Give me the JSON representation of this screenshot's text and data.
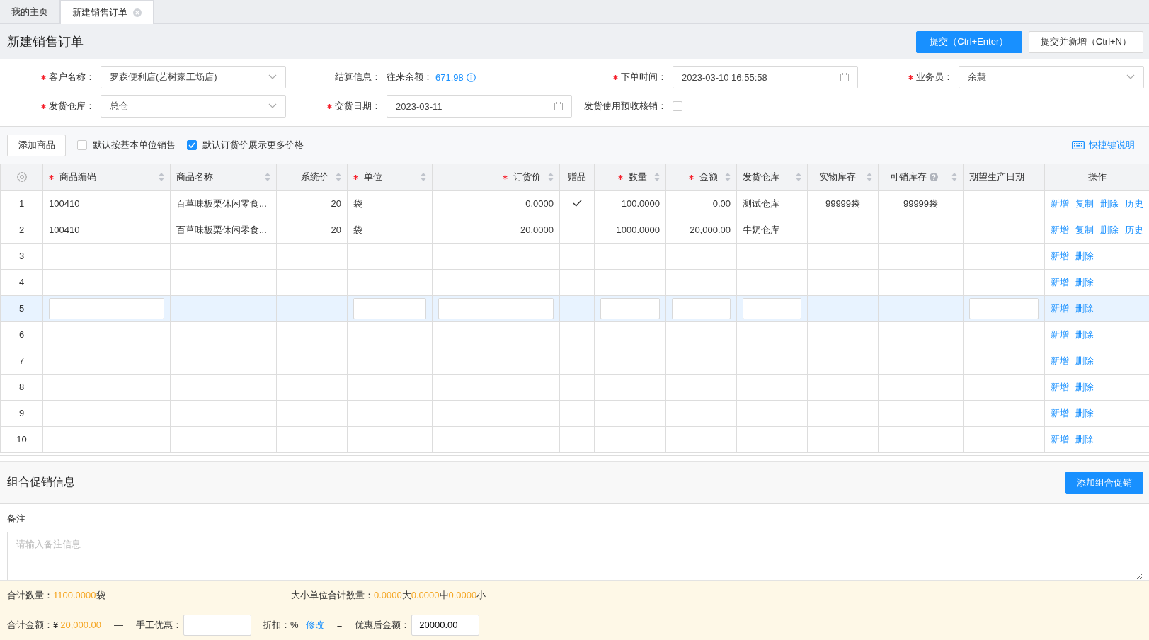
{
  "tabs": [
    {
      "label": "我的主页",
      "selected": false,
      "closable": false
    },
    {
      "label": "新建销售订单",
      "selected": true,
      "closable": true
    }
  ],
  "header": {
    "title": "新建销售订单",
    "buttons": [
      {
        "label": "提交（Ctrl+Enter）",
        "kind": "primary"
      },
      {
        "label": "提交并新增（Ctrl+N）",
        "kind": "default"
      }
    ]
  },
  "form": {
    "fields": [
      {
        "kind": "select",
        "label": "客户名称：",
        "required": true,
        "value": "罗森便利店(艺树家工场店)"
      },
      {
        "kind": "info",
        "label": "结算信息：",
        "required": false,
        "caption": "往来余额：",
        "value": "671.98"
      },
      {
        "kind": "date",
        "label": "下单时间：",
        "required": true,
        "value": "2023-03-10 16:55:58"
      },
      {
        "kind": "select",
        "label": "业务员：",
        "required": true,
        "value": "余慧"
      },
      {
        "kind": "select",
        "label": "发货仓库：",
        "required": true,
        "value": "总仓"
      },
      {
        "kind": "date",
        "label": "交货日期：",
        "required": true,
        "value": "2023-03-11"
      },
      {
        "kind": "checkbox",
        "label": "发货使用预收核销：",
        "required": false,
        "checked": false
      }
    ]
  },
  "toolbar": {
    "add_button": "添加商品",
    "options": [
      {
        "label": "默认按基本单位销售",
        "checked": false
      },
      {
        "label": "默认订货价展示更多价格",
        "checked": true
      }
    ],
    "shortcut_link": "快捷键说明"
  },
  "table": {
    "columns": [
      {
        "kind": "text",
        "label": "商品编码",
        "required": true,
        "sortable": true,
        "editable": true,
        "help": false
      },
      {
        "kind": "text",
        "label": "商品名称",
        "required": false,
        "sortable": true,
        "editable": false,
        "help": false
      },
      {
        "kind": "text",
        "label": "系统价",
        "required": false,
        "sortable": true,
        "editable": false,
        "help": false
      },
      {
        "kind": "text",
        "label": "单位",
        "required": true,
        "sortable": true,
        "editable": true,
        "help": false
      },
      {
        "kind": "text",
        "label": "订货价",
        "required": true,
        "sortable": true,
        "editable": true,
        "help": false
      },
      {
        "kind": "check",
        "label": "赠品",
        "required": false,
        "sortable": false,
        "editable": false,
        "help": false
      },
      {
        "kind": "text",
        "label": "数量",
        "required": true,
        "sortable": true,
        "editable": true,
        "help": false
      },
      {
        "kind": "text",
        "label": "金额",
        "required": true,
        "sortable": true,
        "editable": true,
        "help": false
      },
      {
        "kind": "text",
        "label": "发货仓库",
        "required": false,
        "sortable": true,
        "editable": true,
        "help": false
      },
      {
        "kind": "text",
        "label": "实物库存",
        "required": false,
        "sortable": true,
        "editable": false,
        "help": false
      },
      {
        "kind": "text",
        "label": "可销库存",
        "required": false,
        "sortable": true,
        "editable": false,
        "help": true
      },
      {
        "kind": "text",
        "label": "期望生产日期",
        "required": false,
        "sortable": false,
        "editable": true,
        "help": false
      }
    ],
    "actions_label": "操作",
    "rows": [
      {
        "no": "1",
        "selected": false,
        "gift": true,
        "cells": [
          "100410",
          "百草味板栗休闲零食...",
          "20",
          "袋",
          "0.0000",
          "100.0000",
          "0.00",
          "测试仓库",
          "99999袋",
          "99999袋",
          null
        ],
        "actions": [
          "新增",
          "复制",
          "删除",
          "历史"
        ]
      },
      {
        "no": "2",
        "selected": false,
        "gift": false,
        "cells": [
          "100410",
          "百草味板栗休闲零食...",
          "20",
          "袋",
          "20.0000",
          "1000.0000",
          "20,000.00",
          "牛奶仓库",
          null,
          null,
          null
        ],
        "actions": [
          "新增",
          "复制",
          "删除",
          "历史"
        ]
      },
      {
        "no": "3",
        "selected": false,
        "gift": false,
        "actions": [
          "新增",
          "删除"
        ]
      },
      {
        "no": "4",
        "selected": false,
        "gift": false,
        "actions": [
          "新增",
          "删除"
        ]
      },
      {
        "no": "5",
        "selected": true,
        "gift": false,
        "actions": [
          "新增",
          "删除"
        ]
      },
      {
        "no": "6",
        "selected": false,
        "gift": false,
        "actions": [
          "新增",
          "删除"
        ]
      },
      {
        "no": "7",
        "selected": false,
        "gift": false,
        "actions": [
          "新增",
          "删除"
        ]
      },
      {
        "no": "8",
        "selected": false,
        "gift": false,
        "actions": [
          "新增",
          "删除"
        ]
      },
      {
        "no": "9",
        "selected": false,
        "gift": false,
        "actions": [
          "新增",
          "删除"
        ]
      },
      {
        "no": "10",
        "selected": false,
        "gift": false,
        "actions": [
          "新增",
          "删除"
        ]
      }
    ]
  },
  "promotion": {
    "title": "组合促销信息",
    "button": "添加组合促销"
  },
  "remark": {
    "label": "备注",
    "placeholder": "请输入备注信息"
  },
  "summary": {
    "total_qty": {
      "label": "合计数量：",
      "parts": [
        {
          "text": "1100.0000",
          "highlight": true
        },
        {
          "text": "袋",
          "highlight": false
        }
      ]
    },
    "unit_qty": {
      "label": "大小单位合计数量：",
      "parts": [
        {
          "text": "0.0000",
          "highlight": true
        },
        {
          "text": "大",
          "highlight": false
        },
        {
          "text": "0.0000",
          "highlight": true
        },
        {
          "text": "中",
          "highlight": false
        },
        {
          "text": "0.0000",
          "highlight": true
        },
        {
          "text": "小",
          "highlight": false
        }
      ]
    },
    "total_amount": {
      "label": "合计金额：",
      "currency": "¥",
      "value": "20,000.00"
    },
    "minus": "—",
    "manual_discount_label": "手工优惠：",
    "discount_label": "折扣：%",
    "modify_link": "修改",
    "equals": "=",
    "final_label": "优惠后金额：",
    "final_value": "20000.00"
  }
}
